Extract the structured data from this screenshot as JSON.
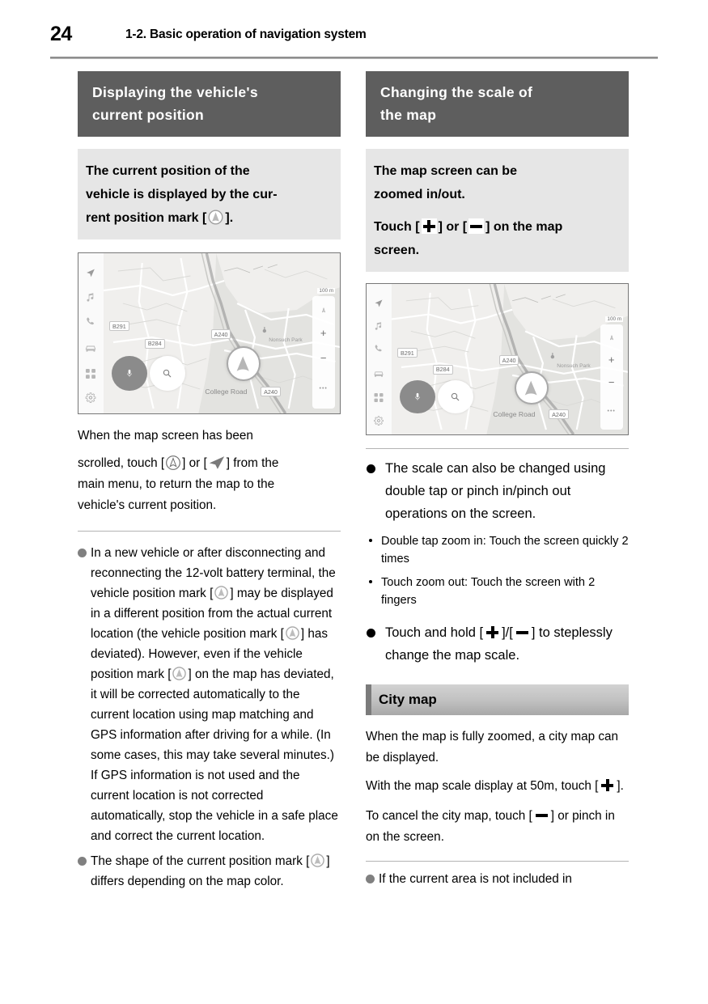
{
  "header": {
    "page_number": "24",
    "chapter_title": "1-2. Basic operation of navigation system"
  },
  "left_column": {
    "section_title_line1": "Displaying the vehicle's",
    "section_title_line2": "current position",
    "statement": {
      "line1": "The current position of the",
      "line2": "vehicle is displayed by the cur-",
      "line3_before": "rent position mark [",
      "line3_after": "]."
    },
    "paragraph": {
      "line1": "When the map screen has been",
      "line2_a": "scrolled, touch [",
      "line2_b": "] or [",
      "line2_c": "] from the",
      "line3": "main menu, to return the map to the",
      "line4": "vehicle's current position."
    },
    "notes": [
      {
        "seg1": "In a new vehicle or after disconnecting and reconnecting the 12-volt battery terminal, the vehicle position mark [",
        "seg2": "] may be displayed in a different position from the actual current location (the vehicle position mark [",
        "seg3": "] has deviated). However, even if the vehicle position mark [",
        "seg4": "] on the map has deviated, it will be corrected automatically to the current location using map matching and GPS information after driving for a while. (In some cases, this may take several minutes.) If GPS information is not used and the current location is not corrected automatically, stop the vehicle in a safe place and correct the current location."
      },
      {
        "seg1": "The shape of the current position mark [",
        "seg2": "] differs depending on the map color."
      }
    ]
  },
  "right_column": {
    "section_title_line1": "Changing the scale of",
    "section_title_line2": "the map",
    "statement": {
      "line1": "The map screen can be",
      "line2": "zoomed in/out.",
      "para2_a": "Touch [",
      "para2_b": "] or [",
      "para2_c": "] on the map",
      "para2_d": "screen."
    },
    "bullets": [
      "The scale can also be changed using double tap or pinch in/pinch out operations on the screen."
    ],
    "sub_items": [
      "Double tap zoom in: Touch the screen quickly 2 times",
      "Touch zoom out: Touch the screen with 2 fingers"
    ],
    "bullet_touch_hold": {
      "a": "Touch and hold [",
      "b": "]/[",
      "c": "] to steplessly change the map scale."
    },
    "sub_header": "City map",
    "city_map_text": {
      "p1": "When the map is fully zoomed, a city map can be displayed.",
      "p2_a": "With the map scale display at 50m, touch [",
      "p2_b": "].",
      "p3_a": "To cancel the city map, touch [",
      "p3_b": "] or pinch in on the screen."
    },
    "footer_note": "If the current area is not included in"
  },
  "map_screen": {
    "scale": "100 m",
    "road_labels": [
      "B291",
      "B284",
      "A240",
      "A240"
    ],
    "street_name": "College Road",
    "poi_name": "Nonsuch Park",
    "zoom_in": "+",
    "zoom_out": "−",
    "more": "•••",
    "sidebar_icons": [
      "navigation-arrow-icon",
      "music-note-icon",
      "phone-icon",
      "car-icon",
      "apps-grid-icon",
      "settings-gear-icon"
    ],
    "buttons": [
      "microphone-button",
      "search-button"
    ]
  },
  "colors": {
    "banner_bg": "#5e5e5e",
    "gray_box_bg": "#e6e6e6",
    "subheader_tab": "#7b7b7b",
    "bullet_gray": "#808080"
  }
}
